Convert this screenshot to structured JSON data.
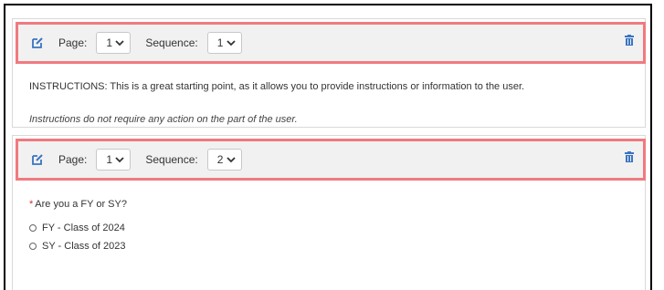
{
  "colors": {
    "accent": "#3a74c2",
    "highlight_border": "#f07a7f",
    "required": "#d0342c"
  },
  "blocks": [
    {
      "page_label": "Page:",
      "page_value": "1",
      "sequence_label": "Sequence:",
      "sequence_value": "1",
      "icons": {
        "edit": "edit-icon",
        "delete": "trash-icon"
      },
      "instruction": "INSTRUCTIONS: This is  a great starting point, as it allows you to provide instructions or information to the user.",
      "note": "Instructions do not require any action on the part of the user."
    },
    {
      "page_label": "Page:",
      "page_value": "1",
      "sequence_label": "Sequence:",
      "sequence_value": "2",
      "icons": {
        "edit": "edit-icon",
        "delete": "trash-icon"
      },
      "required_marker": "*",
      "question": "Are you a FY or SY?",
      "options": [
        "FY - Class of 2024",
        "SY - Class of 2023"
      ]
    }
  ]
}
